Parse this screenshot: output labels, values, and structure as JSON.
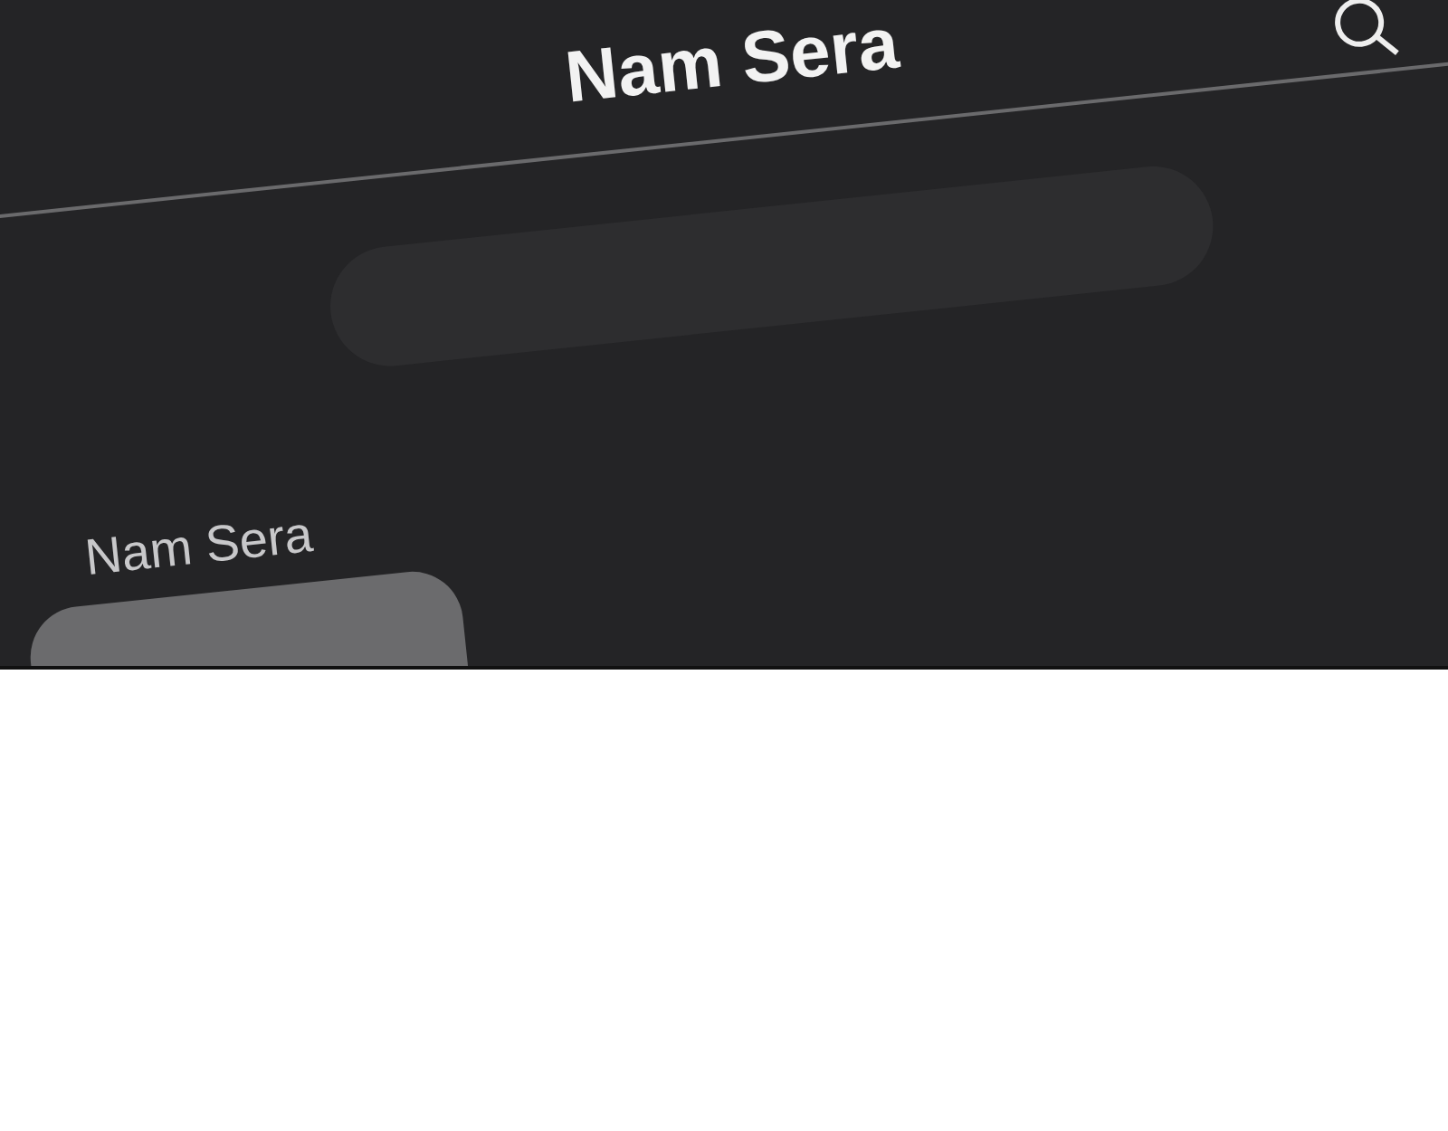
{
  "header": {
    "title": "Nam Sera"
  },
  "messages": [
    {
      "sender": "Nam Sera"
    }
  ]
}
